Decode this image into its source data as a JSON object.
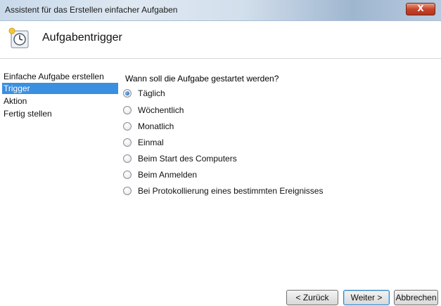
{
  "window": {
    "title": "Assistent für das Erstellen einfacher Aufgaben",
    "close_label": "X"
  },
  "header": {
    "title": "Aufgabentrigger",
    "icon": "task-clock-icon"
  },
  "sidebar": {
    "items": [
      {
        "label": "Einfache Aufgabe erstellen",
        "active": false
      },
      {
        "label": "Trigger",
        "active": true
      },
      {
        "label": "Aktion",
        "active": false
      },
      {
        "label": "Fertig stellen",
        "active": false
      }
    ]
  },
  "content": {
    "question": "Wann soll die Aufgabe gestartet werden?",
    "options": [
      {
        "label": "Täglich",
        "selected": true
      },
      {
        "label": "Wöchentlich",
        "selected": false
      },
      {
        "label": "Monatlich",
        "selected": false
      },
      {
        "label": "Einmal",
        "selected": false
      },
      {
        "label": "Beim Start des Computers",
        "selected": false
      },
      {
        "label": "Beim Anmelden",
        "selected": false
      },
      {
        "label": "Bei Protokollierung eines bestimmten Ereignisses",
        "selected": false
      }
    ]
  },
  "footer": {
    "back_label": "< Zurück",
    "next_label": "Weiter >",
    "cancel_label": "Abbrechen"
  },
  "colors": {
    "selection": "#3a8fe0",
    "close_button": "#c8442a"
  }
}
